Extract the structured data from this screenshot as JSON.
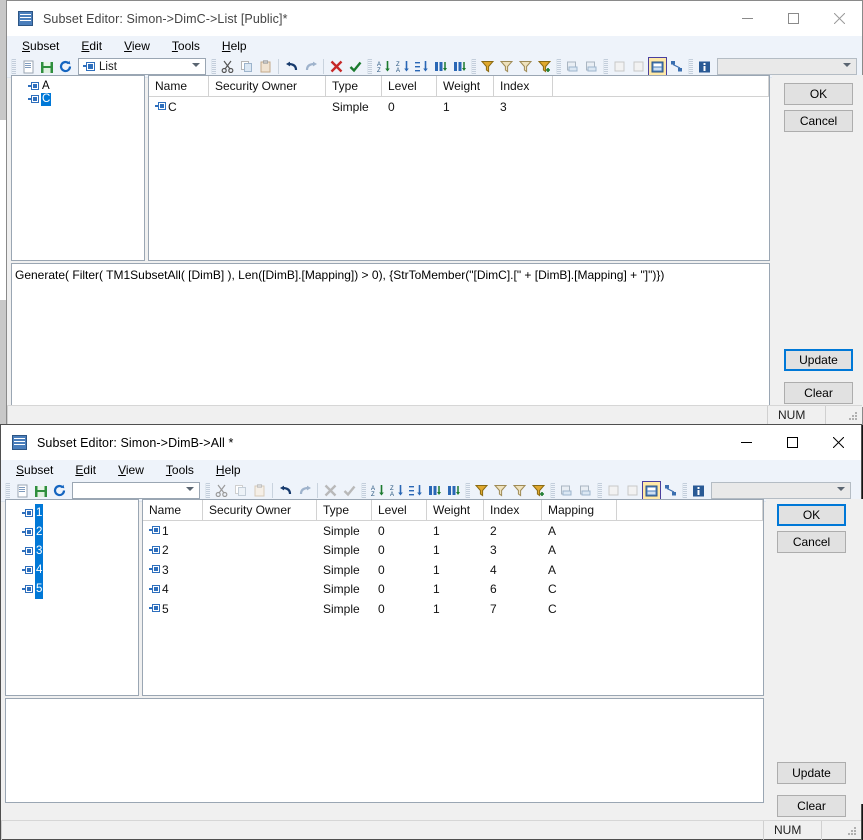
{
  "desktop": {
    "background": "#1d1d1d"
  },
  "windows": [
    {
      "id": "subset-editor-dimc",
      "title": "Subset Editor: Simon->DimC->List  [Public]*",
      "active": false,
      "menu": [
        "Subset",
        "Edit",
        "View",
        "Tools",
        "Help"
      ],
      "toolbar": {
        "subset_combo_value": "List",
        "right_combo_value": ""
      },
      "tree": {
        "items": [
          {
            "label": "A",
            "selected": false
          },
          {
            "label": "C",
            "selected": true
          }
        ]
      },
      "grid": {
        "columns": [
          "Name",
          "Security Owner",
          "Type",
          "Level",
          "Weight",
          "Index"
        ],
        "rows": [
          {
            "Name": "C",
            "Security Owner": "",
            "Type": "Simple",
            "Level": "0",
            "Weight": "1",
            "Index": "3"
          }
        ]
      },
      "expression": "Generate( Filter( TM1SubsetAll( [DimB] ), Len([DimB].[Mapping]) > 0), {StrToMember(\"[DimC].[\" + [DimB].[Mapping] + \"]\")})",
      "buttons": {
        "ok": "OK",
        "cancel": "Cancel",
        "update": "Update",
        "clear": "Clear",
        "focused": "update"
      },
      "statusbar": {
        "num": "NUM"
      },
      "window_controls": {
        "minimize": "minimize-icon",
        "maximize": "maximize-icon",
        "close": "close-icon"
      }
    },
    {
      "id": "subset-editor-dimb",
      "title": "Subset Editor: Simon->DimB->All  *",
      "active": true,
      "menu": [
        "Subset",
        "Edit",
        "View",
        "Tools",
        "Help"
      ],
      "toolbar": {
        "subset_combo_value": "",
        "right_combo_value": ""
      },
      "tree": {
        "items": [
          {
            "label": "1",
            "selected": true
          },
          {
            "label": "2",
            "selected": true
          },
          {
            "label": "3",
            "selected": true
          },
          {
            "label": "4",
            "selected": true
          },
          {
            "label": "5",
            "selected": true
          }
        ]
      },
      "grid": {
        "columns": [
          "Name",
          "Security Owner",
          "Type",
          "Level",
          "Weight",
          "Index",
          "Mapping"
        ],
        "rows": [
          {
            "Name": "1",
            "Security Owner": "",
            "Type": "Simple",
            "Level": "0",
            "Weight": "1",
            "Index": "2",
            "Mapping": "A"
          },
          {
            "Name": "2",
            "Security Owner": "",
            "Type": "Simple",
            "Level": "0",
            "Weight": "1",
            "Index": "3",
            "Mapping": "A"
          },
          {
            "Name": "3",
            "Security Owner": "",
            "Type": "Simple",
            "Level": "0",
            "Weight": "1",
            "Index": "4",
            "Mapping": "A"
          },
          {
            "Name": "4",
            "Security Owner": "",
            "Type": "Simple",
            "Level": "0",
            "Weight": "1",
            "Index": "6",
            "Mapping": "C"
          },
          {
            "Name": "5",
            "Security Owner": "",
            "Type": "Simple",
            "Level": "0",
            "Weight": "1",
            "Index": "7",
            "Mapping": "C"
          }
        ]
      },
      "expression": "",
      "buttons": {
        "ok": "OK",
        "cancel": "Cancel",
        "update": "Update",
        "clear": "Clear",
        "focused": "ok"
      },
      "statusbar": {
        "num": "NUM"
      },
      "window_controls": {
        "minimize": "minimize-icon",
        "maximize": "maximize-icon",
        "close": "close-icon"
      }
    }
  ],
  "toolbar_icons": [
    "new-subset-icon",
    "save-icon",
    "refresh-icon",
    "cut-icon",
    "copy-icon",
    "paste-icon",
    "undo-icon",
    "redo-icon",
    "delete-icon",
    "confirm-icon",
    "sort-ascending-icon",
    "sort-descending-icon",
    "sort-index-icon",
    "sort-hierarchy-icon",
    "sort-level-icon",
    "filter-icon",
    "filter-top-icon",
    "filter-bottom-icon",
    "filter-advanced-icon",
    "drill-down-icon",
    "drill-up-icon",
    "expand-icon",
    "collapse-icon",
    "alias-icon",
    "hierarchy-icon",
    "info-icon"
  ],
  "colors": {
    "accent": "#0078d7",
    "selection": "#0078d7",
    "toolbar_bg": "#eef3fa",
    "window_bg": "#f0f0f0",
    "grid_bg": "#ffffff",
    "member_icon": "#2e6fbd"
  }
}
